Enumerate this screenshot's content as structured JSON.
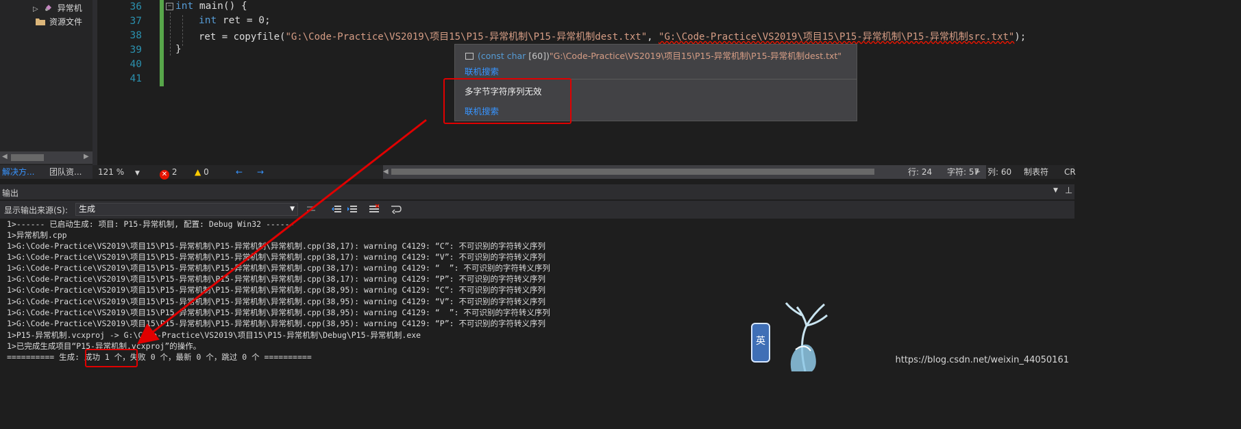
{
  "solution_explorer": {
    "items": [
      {
        "label": "异常机"
      },
      {
        "label": "资源文件"
      }
    ],
    "tabs": [
      "解决方...",
      "团队资..."
    ]
  },
  "editor": {
    "lines": [
      {
        "num": "36",
        "text": "int main() {"
      },
      {
        "num": "37",
        "text": "int ret = 0;"
      },
      {
        "num": "38",
        "text": "ret = copyfile(\"G:\\Code-Practice\\VS2019\\项目15\\P15-异常机制\\P15-异常机制dest.txt\", \"G:\\Code-Practice\\VS2019\\项目15\\P15-异常机制\\P15-异常机制src.txt\");"
      },
      {
        "num": "39",
        "text": "}"
      },
      {
        "num": "40",
        "text": ""
      },
      {
        "num": "41",
        "text": ""
      }
    ],
    "line38_tokens": {
      "pre": "ret = copyfile(",
      "arg1": "\"G:\\Code-Practice\\VS2019\\项目15\\P15-异常机制\\P15-异常机制dest.txt\"",
      "sep": ", ",
      "arg2": "\"G:\\Code-Practice\\VS2019\\项目15\\P15-异常机制\\P15-异常机制src.txt\"",
      "post": ");"
    }
  },
  "tooltip": {
    "type_prefix": "(const char",
    "type_size": " [60])",
    "value": "\"G:\\Code-Practice\\VS2019\\项目15\\P15-异常机制\\P15-异常机制dest.txt\"",
    "search1": "联机搜索",
    "error": "多字节字符序列无效",
    "search2": "联机搜索"
  },
  "status_bar": {
    "zoom": "121 %",
    "errors": "2",
    "warnings": "0",
    "row": "行: 24",
    "char": "字符: 57",
    "col": "列: 60",
    "tabs": "制表符",
    "eol": "CR"
  },
  "output": {
    "title": "输出",
    "source_label": "显示输出来源(S):",
    "source_value": "生成",
    "lines": [
      "1>------ 已启动生成: 项目: P15-异常机制, 配置: Debug Win32 ------",
      "1>异常机制.cpp",
      "1>G:\\Code-Practice\\VS2019\\项目15\\P15-异常机制\\P15-异常机制\\异常机制.cpp(38,17): warning C4129: “C”: 不可识别的字符转义序列",
      "1>G:\\Code-Practice\\VS2019\\项目15\\P15-异常机制\\P15-异常机制\\异常机制.cpp(38,17): warning C4129: “V”: 不可识别的字符转义序列",
      "1>G:\\Code-Practice\\VS2019\\项目15\\P15-异常机制\\P15-异常机制\\异常机制.cpp(38,17): warning C4129: “  ”: 不可识别的字符转义序列",
      "1>G:\\Code-Practice\\VS2019\\项目15\\P15-异常机制\\P15-异常机制\\异常机制.cpp(38,17): warning C4129: “P”: 不可识别的字符转义序列",
      "1>G:\\Code-Practice\\VS2019\\项目15\\P15-异常机制\\P15-异常机制\\异常机制.cpp(38,95): warning C4129: “C”: 不可识别的字符转义序列",
      "1>G:\\Code-Practice\\VS2019\\项目15\\P15-异常机制\\P15-异常机制\\异常机制.cpp(38,95): warning C4129: “V”: 不可识别的字符转义序列",
      "1>G:\\Code-Practice\\VS2019\\项目15\\P15-异常机制\\P15-异常机制\\异常机制.cpp(38,95): warning C4129: “  ”: 不可识别的字符转义序列",
      "1>G:\\Code-Practice\\VS2019\\项目15\\P15-异常机制\\P15-异常机制\\异常机制.cpp(38,95): warning C4129: “P”: 不可识别的字符转义序列",
      "1>P15-异常机制.vcxproj -> G:\\Code-Practice\\VS2019\\项目15\\P15-异常机制\\Debug\\P15-异常机制.exe",
      "1>已完成生成项目“P15-异常机制.vcxproj”的操作。",
      "========== 生成: 成功 1 个，失败 0 个，最新 0 个，跳过 0 个 =========="
    ]
  },
  "watermark": "https://blog.csdn.net/weixin_44050161",
  "avatar_glyph": "英",
  "colors": {
    "annotation_red": "#e00000",
    "link_blue": "#3794ff",
    "line_number": "#2b91af",
    "keyword": "#569cd6",
    "string": "#d69d85"
  }
}
